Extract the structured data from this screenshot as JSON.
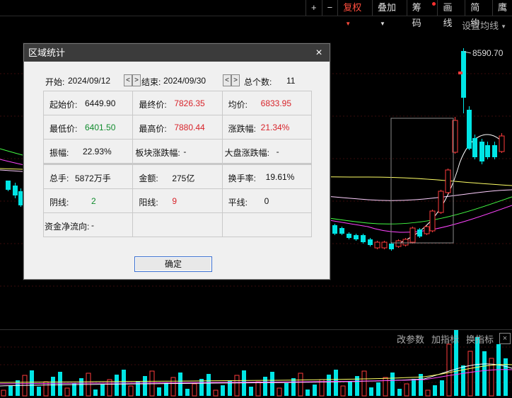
{
  "toolbar": {
    "plus": "+",
    "minus": "−",
    "fuquan": "复权",
    "diejia": "叠加",
    "chouma": "筹码",
    "huaxian": "画线",
    "jianyue": "简约",
    "more": "鹰"
  },
  "chart": {
    "ma_settings": "设置均线",
    "high_label": "8590.70"
  },
  "volume_panel": {
    "change_params": "改参数",
    "add_indicator": "加指标",
    "switch_indicator": "换指标",
    "close": "×"
  },
  "dialog": {
    "title": "区域统计",
    "close": "×",
    "start_label": "开始:",
    "start_date": "2024/09/12",
    "end_label": "结束:",
    "end_date": "2024/09/30",
    "count_label": "总个数:",
    "count_value": "11",
    "arrow_left": "<",
    "arrow_right": ">",
    "open_label": "起始价:",
    "open_value": "6449.90",
    "close_label": "最终价:",
    "close_value": "7826.35",
    "avg_label": "均价:",
    "avg_value": "6833.95",
    "low_label": "最低价:",
    "low_value": "6401.50",
    "high_label": "最高价:",
    "high_value": "7880.44",
    "chg_label": "涨跌幅:",
    "chg_value": "21.34%",
    "amp_label": "振幅:",
    "amp_value": "22.93%",
    "sector_label": "板块涨跌幅:",
    "sector_value": "-",
    "market_label": "大盘涨跌幅:",
    "market_value": "-",
    "vol_label": "总手:",
    "vol_value": "5872万手",
    "amt_label": "金额:",
    "amt_value": "275亿",
    "turnover_label": "换手率:",
    "turnover_value": "19.61%",
    "down_label": "阴线:",
    "down_value": "2",
    "up_label": "阳线:",
    "up_value": "9",
    "flat_label": "平线:",
    "flat_value": "0",
    "flow_label": "资金净流向:",
    "flow_value": "-",
    "ok": "确定"
  },
  "colors": {
    "up": "#ff3b3b",
    "down": "#00e5e5",
    "ma1": "#ffffff",
    "ma2": "#ffff66",
    "ma3": "#ff44ff",
    "ma4": "#44ff44",
    "dialog_red": "#d8232a",
    "dialog_green": "#118c2e"
  }
}
